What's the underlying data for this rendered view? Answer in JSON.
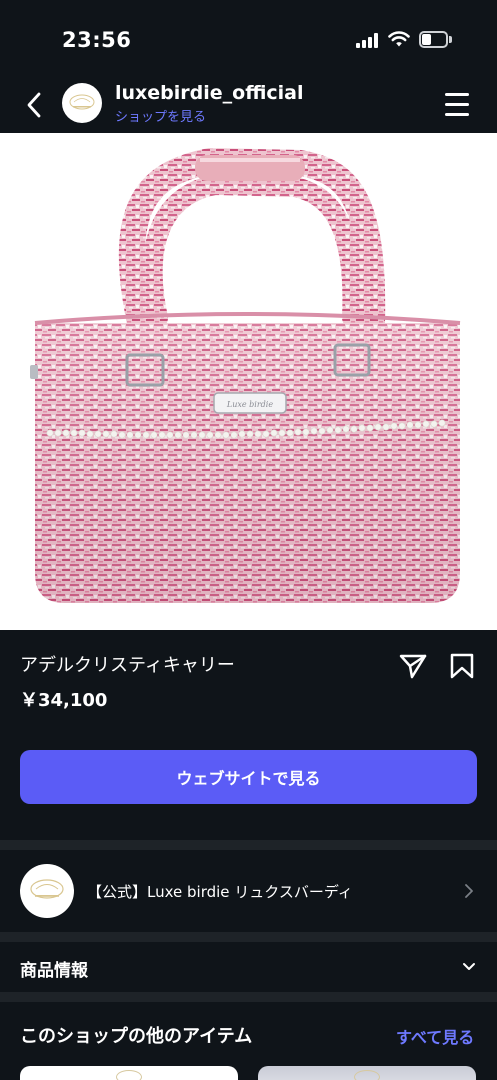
{
  "status": {
    "time": "23:56"
  },
  "header": {
    "shop_name": "luxebirdie_official",
    "shop_link": "ショップを見る",
    "avatar_text": "Luxe birdie"
  },
  "product": {
    "title": "アデルクリスティキャリー",
    "price": "￥34,100",
    "tag_text": "Luxe birdie",
    "colors": {
      "tweed": "#e8a3b8",
      "tweed_dark": "#c94f7a",
      "handle": "#e8aeb9"
    }
  },
  "actions": {
    "website_button": "ウェブサイトで見る"
  },
  "shop_row": {
    "name": "【公式】Luxe birdie リュクスバーディ",
    "avatar_text": "Luxe birdie"
  },
  "info_row": {
    "label": "商品情報"
  },
  "more": {
    "title": "このショップの他のアイテム",
    "see_all": "すべて見る"
  },
  "icons": {
    "back": "chevron-left-icon",
    "menu": "hamburger-menu-icon",
    "share": "send-icon",
    "save": "bookmark-icon",
    "chevron_right": "chevron-right-icon",
    "chevron_down": "chevron-down-icon"
  },
  "accent_color": "#5b5cf6",
  "link_color": "#6e79ff"
}
